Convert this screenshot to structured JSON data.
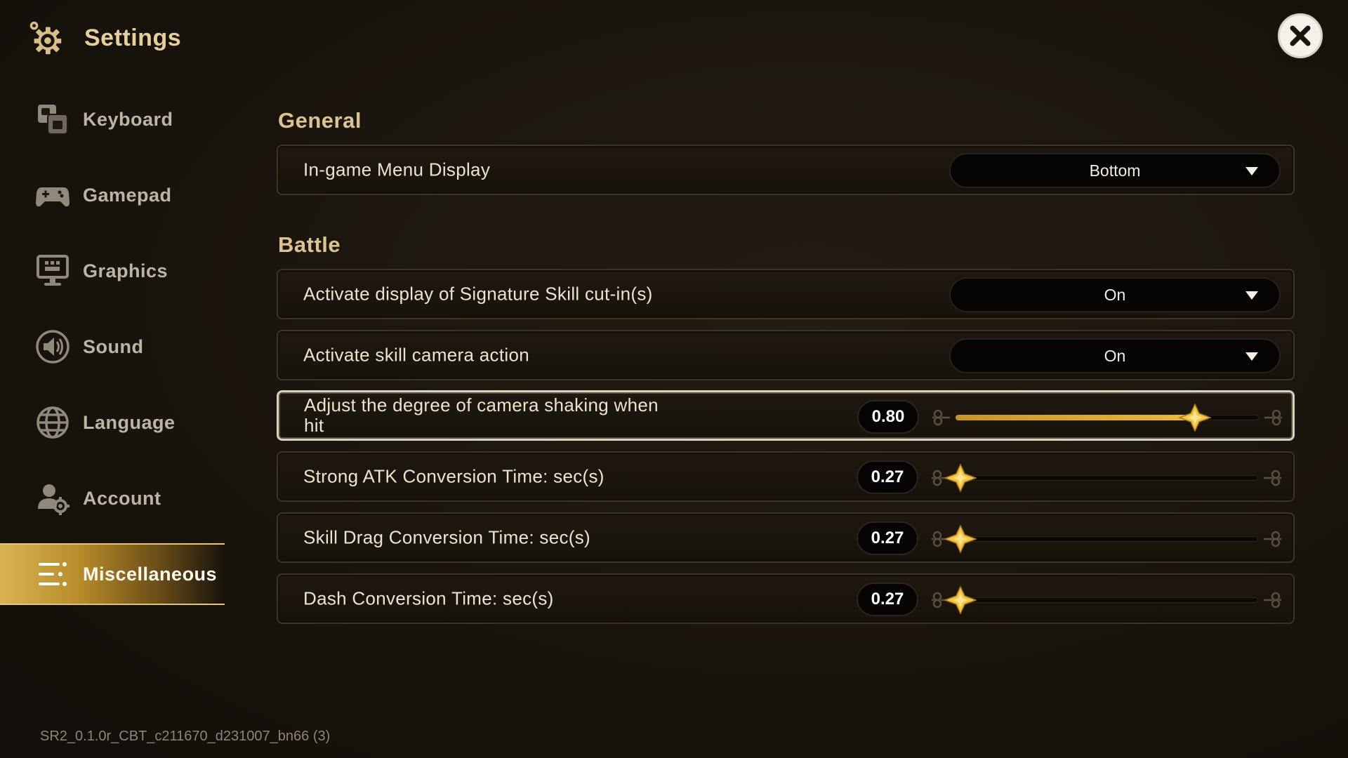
{
  "header": {
    "title": "Settings"
  },
  "sidebar": {
    "items": [
      {
        "label": "Keyboard",
        "icon": "keyboard-icon",
        "active": false
      },
      {
        "label": "Gamepad",
        "icon": "gamepad-icon",
        "active": false
      },
      {
        "label": "Graphics",
        "icon": "monitor-icon",
        "active": false
      },
      {
        "label": "Sound",
        "icon": "speaker-icon",
        "active": false
      },
      {
        "label": "Language",
        "icon": "globe-icon",
        "active": false
      },
      {
        "label": "Account",
        "icon": "account-icon",
        "active": false
      },
      {
        "label": "Miscellaneous",
        "icon": "list-icon",
        "active": true
      }
    ]
  },
  "general": {
    "title": "General",
    "menu_display": {
      "label": "In-game Menu Display",
      "value": "Bottom"
    }
  },
  "battle": {
    "title": "Battle",
    "signature_cutin": {
      "label": "Activate display of Signature Skill cut-in(s)",
      "value": "On"
    },
    "skill_camera": {
      "label": "Activate skill camera action",
      "value": "On"
    },
    "camera_shake": {
      "label": "Adjust the degree of camera shaking when hit",
      "value": "0.80",
      "fraction": 0.8
    },
    "strong_atk": {
      "label": "Strong ATK Conversion Time: sec(s)",
      "value": "0.27",
      "fraction": 0.0
    },
    "skill_drag": {
      "label": "Skill Drag Conversion Time: sec(s)",
      "value": "0.27",
      "fraction": 0.0
    },
    "dash": {
      "label": "Dash Conversion Time: sec(s)",
      "value": "0.27",
      "fraction": 0.0
    }
  },
  "version": "SR2_0.1.0r_CBT_c211670_d231007_bn66 (3)",
  "colors": {
    "accent": "#f0b935",
    "gold_title": "#e7cf98",
    "active_bg": "#c9a23e"
  }
}
